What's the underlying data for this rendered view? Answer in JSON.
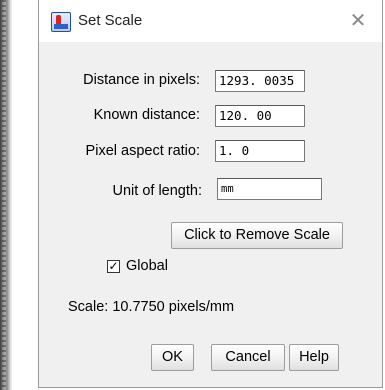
{
  "window": {
    "title": "Set Scale",
    "app_icon": "imagej-microscope-icon",
    "close_icon": "close-icon",
    "close_glyph": "✕"
  },
  "fields": {
    "distance_in_pixels": {
      "label": "Distance in pixels:",
      "value": "1293. 0035"
    },
    "known_distance": {
      "label": "Known distance:",
      "value": "120. 00"
    },
    "pixel_aspect_ratio": {
      "label": "Pixel aspect ratio:",
      "value": "1. 0"
    },
    "unit_of_length": {
      "label": "Unit of length:",
      "value": "mm"
    }
  },
  "buttons": {
    "remove_scale": "Click to Remove Scale",
    "ok": "OK",
    "cancel": "Cancel",
    "help": "Help"
  },
  "global": {
    "label": "Global",
    "checked": true,
    "check_glyph": "✓"
  },
  "scale_text": "Scale: 10.7750 pixels/mm"
}
